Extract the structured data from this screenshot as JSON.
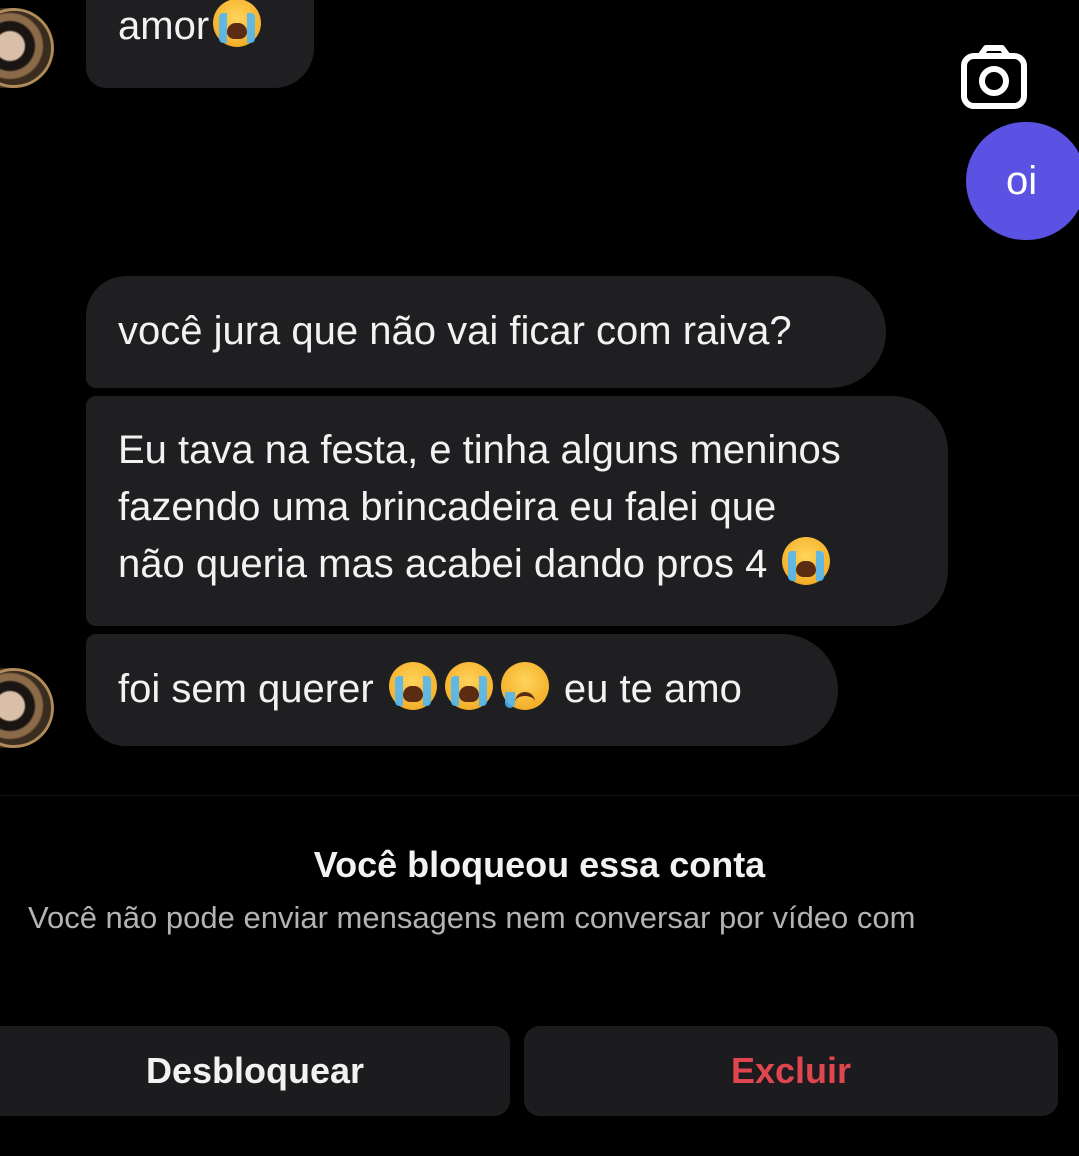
{
  "chat": {
    "messages": [
      {
        "side": "incoming",
        "text": "amor"
      },
      {
        "side": "outgoing",
        "text": "oi"
      },
      {
        "side": "incoming",
        "text": "você jura que não vai ficar com raiva?"
      },
      {
        "side": "incoming",
        "lines": [
          "Eu tava na festa, e tinha alguns meninos",
          "fazendo uma brincadeira eu falei que",
          "não queria mas acabei dando pros 4"
        ]
      },
      {
        "side": "incoming",
        "text_before": "foi sem querer",
        "text_after": "eu te amo"
      }
    ]
  },
  "icons": {
    "camera": "camera-icon",
    "emoji_cry": "loudly-crying-face-emoji",
    "emoji_sad": "crying-face-emoji"
  },
  "blocked": {
    "title": "Você bloqueou essa conta",
    "subtitle": "Você não pode enviar mensagens nem conversar por vídeo com"
  },
  "actions": {
    "unblock_label": "Desbloquear",
    "delete_label": "Excluir"
  },
  "colors": {
    "background": "#000000",
    "incoming_bubble": "#1f1f21",
    "outgoing_bubble": "#5b52e3",
    "delete_text": "#e0464f"
  }
}
